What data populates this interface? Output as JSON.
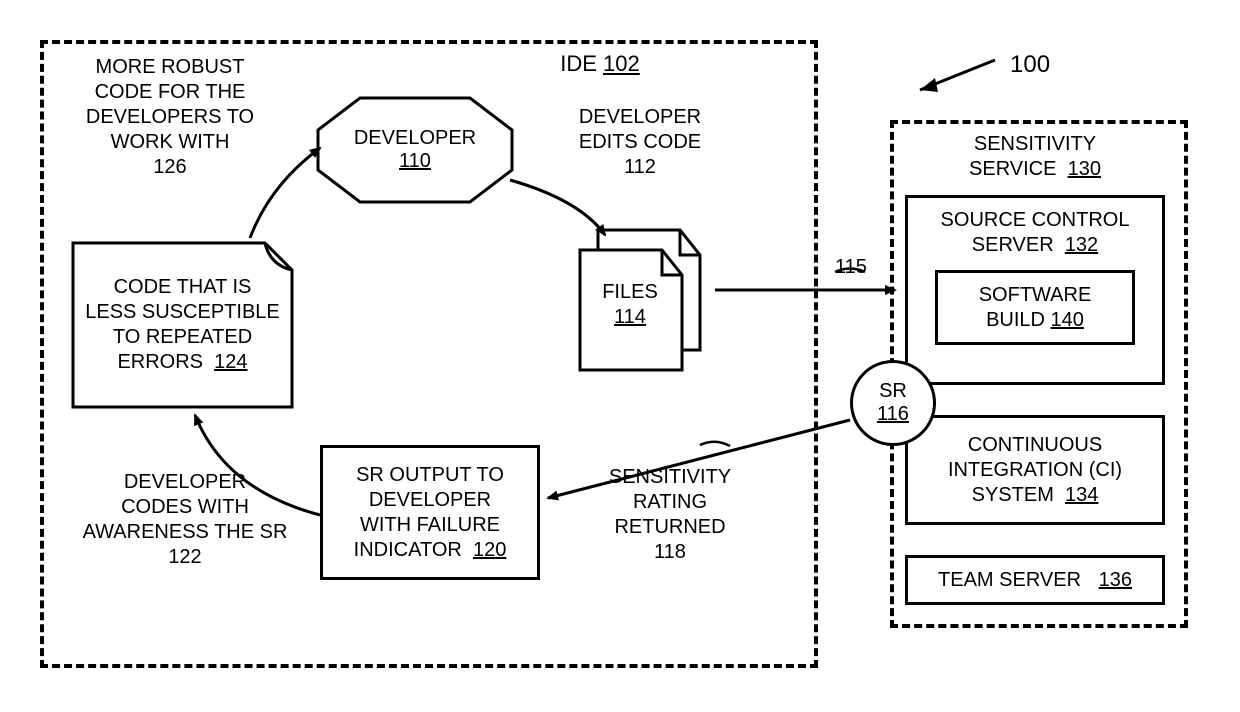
{
  "figure_ref": "100",
  "ide": {
    "label": "IDE",
    "ref": "102",
    "robust_note": "MORE ROBUST CODE FOR THE DEVELOPERS TO WORK WITH",
    "robust_ref": "126",
    "developer": {
      "label": "DEVELOPER",
      "ref": "110"
    },
    "edits_note": "DEVELOPER EDITS CODE",
    "edits_ref": "112",
    "files": {
      "label": "FILES",
      "ref": "114"
    },
    "files_arrow_ref": "115",
    "return_note_l1": "SENSITIVITY",
    "return_note_l2": "RATING",
    "return_note_l3": "RETURNED",
    "return_ref": "118",
    "sr_output": {
      "l1": "SR OUTPUT TO",
      "l2": "DEVELOPER",
      "l3": "WITH FAILURE",
      "l4": "INDICATOR",
      "ref": "120"
    },
    "awareness_note_l1": "DEVELOPER",
    "awareness_note_l2": "CODES WITH",
    "awareness_note_l3": "AWARENESS THE SR",
    "awareness_ref": "122",
    "code_less": {
      "l1": "CODE THAT IS",
      "l2": "LESS SUSCEPTIBLE",
      "l3": "TO REPEATED",
      "l4": "ERRORS",
      "ref": "124"
    }
  },
  "sr_circle": {
    "label": "SR",
    "ref": "116"
  },
  "sensitivity": {
    "label": "SENSITIVITY",
    "label2": "SERVICE",
    "ref": "130",
    "source_control": {
      "l1": "SOURCE CONTROL",
      "l2": "SERVER",
      "ref": "132"
    },
    "software_build": {
      "l1": "SOFTWARE",
      "l2": "BUILD",
      "ref": "140"
    },
    "ci": {
      "l1": "CONTINUOUS",
      "l2": "INTEGRATION  (CI)",
      "l3": "SYSTEM",
      "ref": "134"
    },
    "team_server": {
      "label": "TEAM SERVER",
      "ref": "136"
    }
  }
}
